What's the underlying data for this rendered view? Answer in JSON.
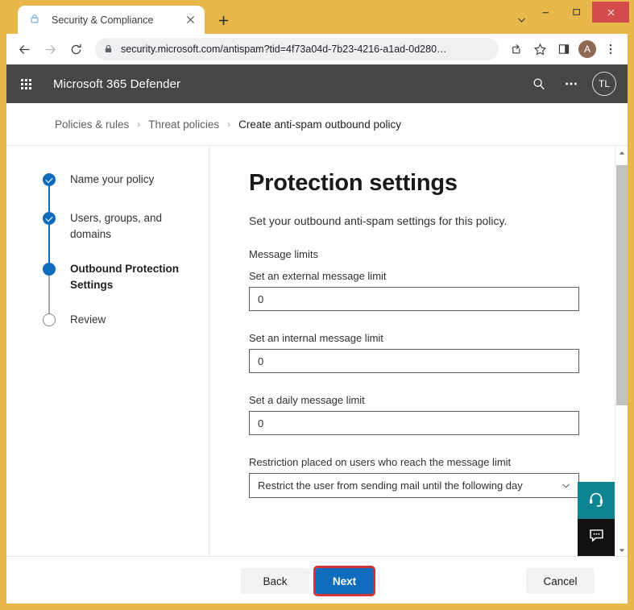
{
  "browser": {
    "tab": {
      "title": "Security & Compliance",
      "lock_icon": "lock-icon",
      "close_icon": "close-icon"
    },
    "new_tab_icon": "plus-icon",
    "tab_list_icon": "chevron-down-icon",
    "window_controls": {
      "minimize": "minimize-icon",
      "maximize": "maximize-icon",
      "close": "close-icon"
    },
    "nav": {
      "back_icon": "arrow-left-icon",
      "forward_icon": "arrow-right-icon",
      "reload_icon": "reload-icon"
    },
    "omnibox": {
      "lock_icon": "lock-icon",
      "url": "security.microsoft.com/antispam?tid=4f73a04d-7b23-4216-a1ad-0d280…",
      "share_icon": "share-icon",
      "favorite_icon": "star-icon"
    },
    "toolbar_icons": {
      "collections": "collections-icon",
      "menu": "more-vertical-icon"
    },
    "profile": {
      "initial": "A",
      "color": "#8d6b52"
    }
  },
  "suite_bar": {
    "waffle_icon": "app-launcher-icon",
    "title": "Microsoft 365 Defender",
    "search_icon": "search-icon",
    "more_icon": "more-horizontal-icon",
    "avatar_initials": "TL",
    "background": "#484644"
  },
  "breadcrumb": {
    "separator": "›",
    "items": [
      {
        "label": "Policies & rules",
        "current": false
      },
      {
        "label": "Threat policies",
        "current": false
      },
      {
        "label": "Create anti-spam outbound policy",
        "current": true
      }
    ]
  },
  "wizard": {
    "steps": [
      {
        "label": "Name your policy",
        "state": "done"
      },
      {
        "label": "Users, groups, and domains",
        "state": "done"
      },
      {
        "label": "Outbound Protection Settings",
        "state": "active"
      },
      {
        "label": "Review",
        "state": "pending"
      }
    ],
    "accent_color": "#0f6cbd"
  },
  "content": {
    "title": "Protection settings",
    "subtitle": "Set your outbound anti-spam settings for this policy.",
    "group_label": "Message limits",
    "fields": [
      {
        "label": "Set an external message limit",
        "value": "0",
        "placeholder": "0"
      },
      {
        "label": "Set an internal message limit",
        "value": "0",
        "placeholder": "0"
      },
      {
        "label": "Set a daily message limit",
        "value": "0",
        "placeholder": "0"
      }
    ],
    "restriction": {
      "label": "Restriction placed on users who reach the message limit",
      "selected": "Restrict the user from sending mail until the following day",
      "caret_icon": "chevron-down-icon"
    }
  },
  "footer": {
    "back_label": "Back",
    "next_label": "Next",
    "cancel_label": "Cancel",
    "next_highlight_color": "#d13438",
    "next_background": "#0f6cbd"
  },
  "fabs": {
    "help": {
      "icon": "headset-icon",
      "color": "#0e8490"
    },
    "feedback": {
      "icon": "feedback-chat-icon",
      "color": "#111111"
    }
  },
  "scrollbar": {
    "up_icon": "caret-up-icon",
    "down_icon": "caret-down-icon"
  }
}
